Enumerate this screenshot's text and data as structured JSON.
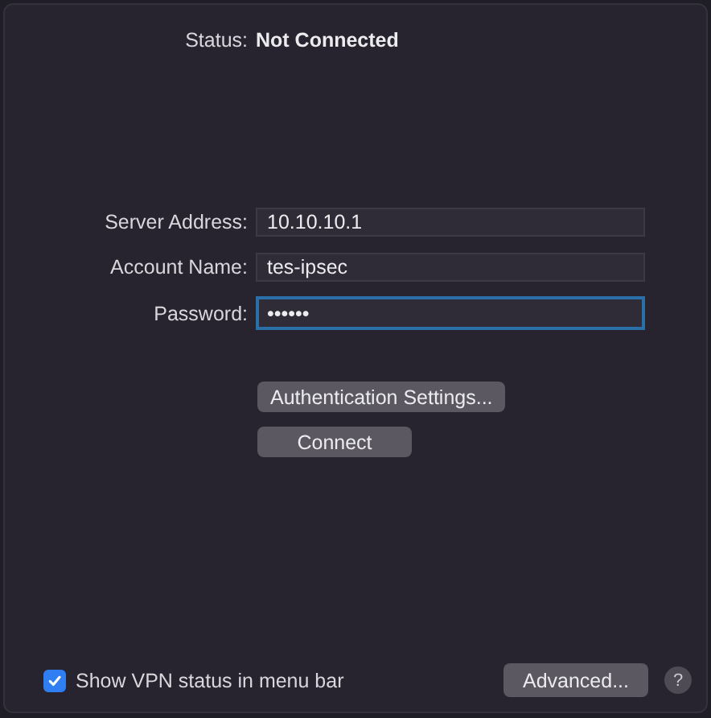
{
  "status": {
    "label": "Status:",
    "value": "Not Connected"
  },
  "fields": [
    {
      "label": "Server Address:",
      "value": "10.10.10.1",
      "focused": false
    },
    {
      "label": "Account Name:",
      "value": "tes-ipsec",
      "focused": false
    },
    {
      "label": "Password:",
      "value": "••••••",
      "focused": true
    }
  ],
  "buttons": [
    "Authentication Settings...",
    "Connect"
  ],
  "show_status_checkbox": {
    "label": "Show VPN status in menu bar",
    "checked": true
  },
  "advanced_button": "Advanced...",
  "help_button": "?"
}
